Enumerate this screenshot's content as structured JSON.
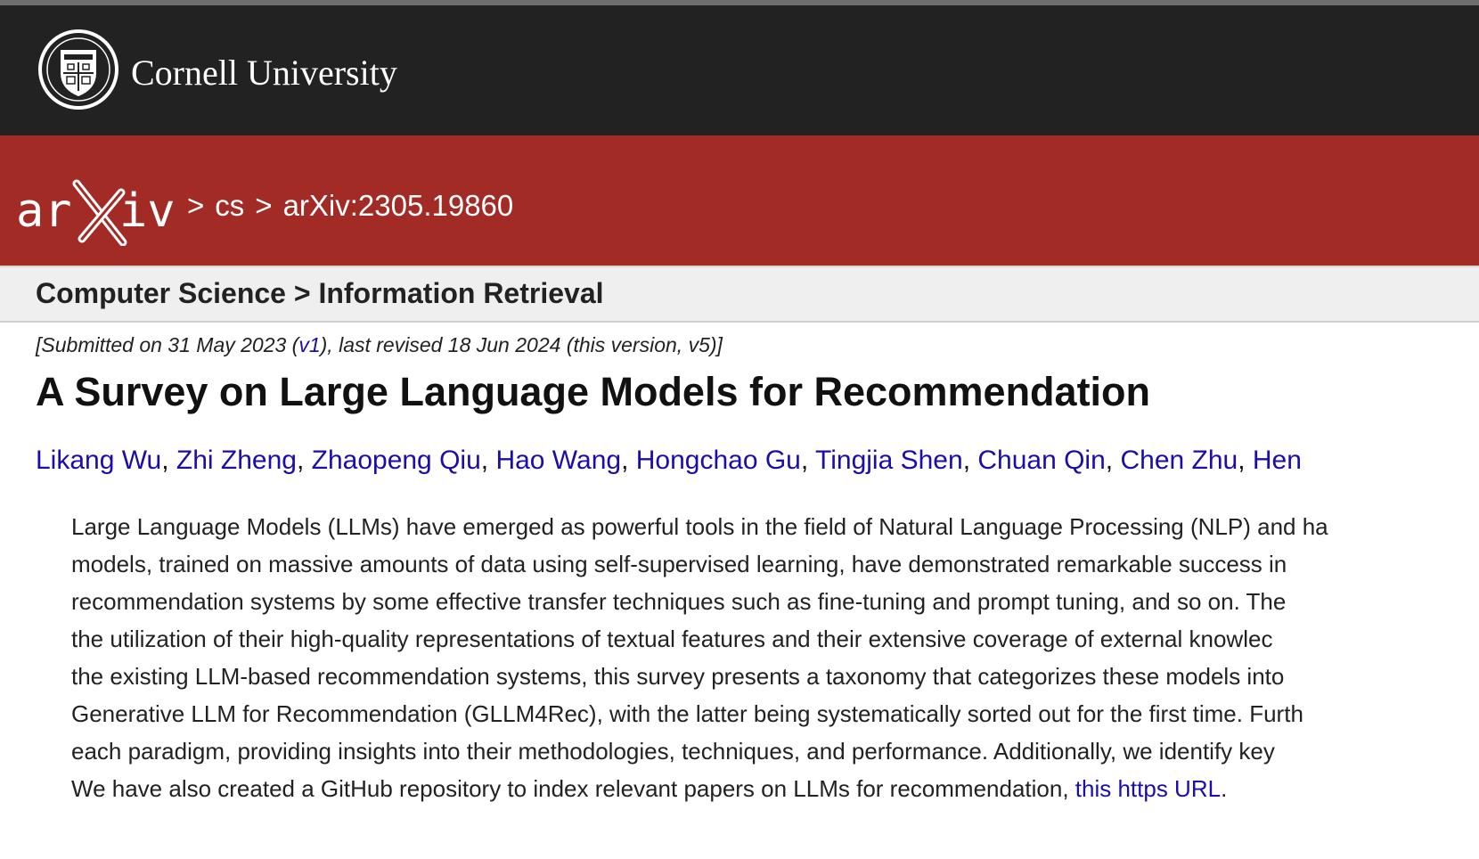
{
  "header": {
    "institution": "Cornell University"
  },
  "breadcrumbs": {
    "sep1": ">",
    "section": "cs",
    "sep2": ">",
    "paper_id": "arXiv:2305.19860"
  },
  "subject": "Computer Science > Information Retrieval",
  "submission": {
    "prefix": "[Submitted on 31 May 2023 (",
    "v1_link": "v1",
    "suffix": "), last revised 18 Jun 2024 (this version, v5)]"
  },
  "title": "A Survey on Large Language Models for Recommendation",
  "authors": [
    "Likang Wu",
    "Zhi Zheng",
    "Zhaopeng Qiu",
    "Hao Wang",
    "Hongchao Gu",
    "Tingjia Shen",
    "Chuan Qin",
    "Chen Zhu",
    "Hen"
  ],
  "abstract": {
    "lines": [
      "Large Language Models (LLMs) have emerged as powerful tools in the field of Natural Language Processing (NLP) and ha",
      "models, trained on massive amounts of data using self-supervised learning, have demonstrated remarkable success in",
      "recommendation systems by some effective transfer techniques such as fine-tuning and prompt tuning, and so on. The",
      "the utilization of their high-quality representations of textual features and their extensive coverage of external knowlec",
      "the existing LLM-based recommendation systems, this survey presents a taxonomy that categorizes these models into",
      "Generative LLM for Recommendation (GLLM4Rec), with the latter being systematically sorted out for the first time. Furth",
      "each paradigm, providing insights into their methodologies, techniques, and performance. Additionally, we identify key"
    ],
    "last_line_text": "We have also created a GitHub repository to index relevant papers on LLMs for recommendation, ",
    "link": "this https URL",
    "last_line_end": "."
  },
  "colors": {
    "cornell_bar": "#222222",
    "arxiv_red": "#a32b26",
    "link_blue": "#1a0dab",
    "subject_bar": "#efefef"
  }
}
